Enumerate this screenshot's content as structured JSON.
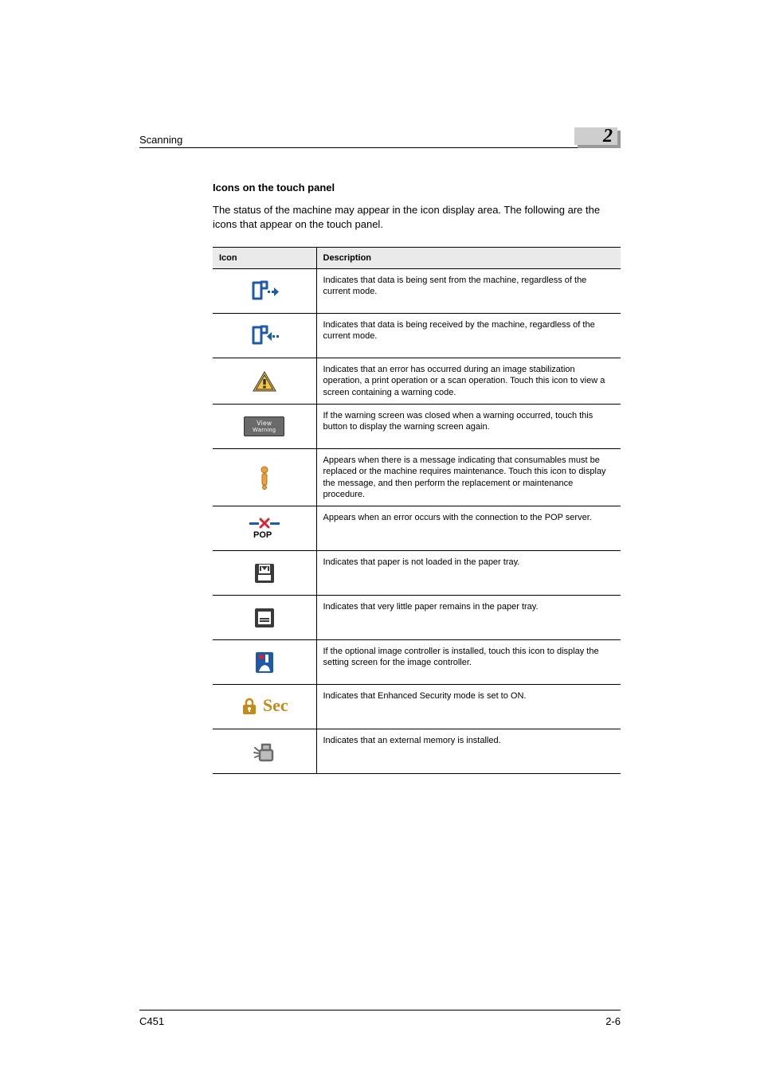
{
  "header": {
    "section": "Scanning",
    "chapter": "2"
  },
  "title": "Icons on the touch panel",
  "intro": "The status of the machine may appear in the icon display area. The following are the icons that appear on the touch panel.",
  "table": {
    "head": {
      "c1": "Icon",
      "c2": "Description"
    },
    "rows": [
      {
        "icon": "data-send",
        "desc": "Indicates that data is being sent from the machine, regardless of the current mode."
      },
      {
        "icon": "data-recv",
        "desc": "Indicates that data is being received by the machine, regardless of the current mode."
      },
      {
        "icon": "warning-triangle",
        "desc": "Indicates that an error has occurred during an image stabilization operation, a print operation or a scan operation.\nTouch this icon to view a screen containing a warning code."
      },
      {
        "icon": "view-warning",
        "desc": "If the warning screen was closed when a warning occurred, touch this button to display the warning screen again."
      },
      {
        "icon": "consumable",
        "desc": "Appears when there is a message indicating that consumables must be replaced or the machine requires maintenance. Touch this icon to display the message, and then perform the replacement or maintenance procedure."
      },
      {
        "icon": "pop-error",
        "desc": "Appears when an error occurs with the connection to the POP server."
      },
      {
        "icon": "no-paper",
        "desc": "Indicates that paper is not loaded in the paper tray."
      },
      {
        "icon": "low-paper",
        "desc": "Indicates that very little paper remains in the paper tray."
      },
      {
        "icon": "image-ctrl",
        "desc": "If the optional image controller is installed, touch this icon to display the setting screen for the image controller."
      },
      {
        "icon": "sec",
        "desc": "Indicates that Enhanced Security mode is set to ON."
      },
      {
        "icon": "ext-memory",
        "desc": "Indicates that an external memory is installed."
      }
    ]
  },
  "labels": {
    "view_warning_l1": "View",
    "view_warning_l2": "Warning",
    "pop_text": "POP",
    "sec_text": "Sec"
  },
  "footer": {
    "left": "C451",
    "right": "2-6"
  }
}
